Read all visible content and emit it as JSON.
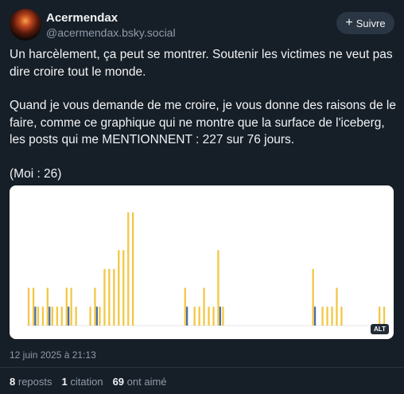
{
  "author": {
    "display_name": "Acermendax",
    "handle": "@acermendax.bsky.social"
  },
  "follow_label": "Suivre",
  "post": {
    "line1": "Un harcèlement, ça peut se montrer. Soutenir les victimes ne veut pas dire croire tout le monde.",
    "line2": "Quand je vous demande de me croire, je vous donne des raisons de le faire, comme ce graphique qui ne montre que la surface de l'iceberg, les posts qui me MENTIONNENT : 227 sur 76 jours.",
    "line3": "(Moi : 26)"
  },
  "alt_label": "ALT",
  "timestamp": "12 juin 2025 à 21:13",
  "stats": {
    "reposts_count": "8",
    "reposts_label": "reposts",
    "citations_count": "1",
    "citations_label": "citation",
    "likes_count": "69",
    "likes_label": "ont aimé"
  },
  "colors": {
    "background": "#161e27",
    "yellow_series": "#f2c744",
    "blue_series": "#4a6fa5"
  },
  "chart_data": {
    "type": "bar",
    "days": 76,
    "series": [
      {
        "color": "#f2c744",
        "values": [
          2,
          2,
          1,
          1,
          2,
          1,
          1,
          1,
          2,
          2,
          1,
          0,
          0,
          1,
          2,
          1,
          3,
          3,
          3,
          4,
          4,
          6,
          6,
          0,
          0,
          0,
          0,
          0,
          0,
          0,
          0,
          0,
          0,
          2,
          0,
          1,
          1,
          2,
          1,
          1,
          4,
          1,
          0,
          0,
          0,
          0,
          0,
          0,
          0,
          0,
          0,
          0,
          0,
          0,
          0,
          0,
          0,
          0,
          0,
          0,
          3,
          0,
          1,
          1,
          1,
          2,
          1,
          0,
          0,
          0,
          0,
          0,
          0,
          0,
          1,
          1
        ]
      },
      {
        "color": "#4a6fa5",
        "values": [
          0,
          1,
          0,
          0,
          1,
          0,
          0,
          0,
          1,
          0,
          0,
          0,
          0,
          0,
          1,
          0,
          0,
          0,
          0,
          0,
          0,
          0,
          0,
          0,
          0,
          0,
          0,
          0,
          0,
          0,
          0,
          0,
          0,
          1,
          0,
          0,
          0,
          0,
          0,
          0,
          1,
          0,
          0,
          0,
          0,
          0,
          0,
          0,
          0,
          0,
          0,
          0,
          0,
          0,
          0,
          0,
          0,
          0,
          0,
          0,
          1,
          0,
          0,
          0,
          0,
          0,
          0,
          0,
          0,
          0,
          0,
          0,
          0,
          0,
          0,
          0
        ]
      }
    ]
  }
}
